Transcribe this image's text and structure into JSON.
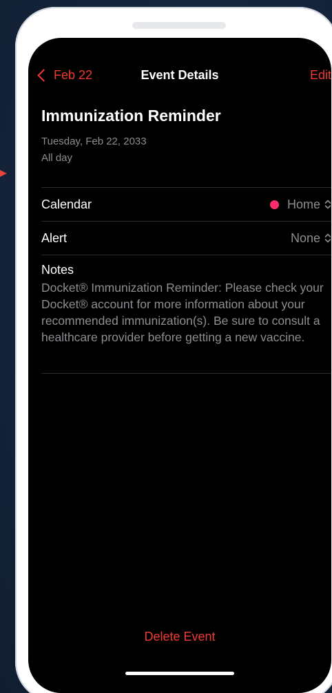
{
  "nav": {
    "back_label": "Feb 22",
    "title": "Event Details",
    "edit_label": "Edit"
  },
  "event": {
    "title": "Immunization Reminder",
    "date": "Tuesday, Feb 22, 2033",
    "time": "All day"
  },
  "calendar": {
    "label": "Calendar",
    "value": "Home",
    "dot_color": "#ff2d6b"
  },
  "alert": {
    "label": "Alert",
    "value": "None"
  },
  "notes": {
    "label": "Notes",
    "text": "Docket® Immunization Reminder: Please check your Docket® account for more information about your recommended immunization(s). Be sure to consult a healthcare provider before getting a new vaccine."
  },
  "footer": {
    "delete_label": "Delete Event"
  },
  "colors": {
    "accent": "#f03a32",
    "background": "#000000",
    "secondary_text": "#8e8e93"
  },
  "icons": {
    "back": "chevron-left-icon",
    "selector": "chevron-up-down-icon",
    "pointer": "arrow-right-icon"
  }
}
